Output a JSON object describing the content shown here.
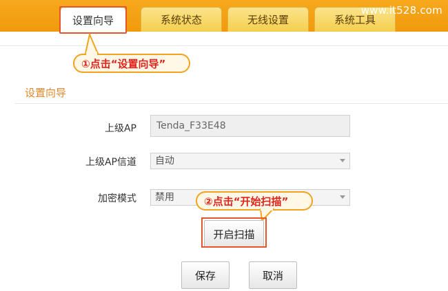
{
  "tabs": [
    {
      "label": "设置向导",
      "active": true
    },
    {
      "label": "系统状态",
      "active": false
    },
    {
      "label": "无线设置",
      "active": false
    },
    {
      "label": "系统工具",
      "active": false
    }
  ],
  "watermark": "www.it528.com",
  "callouts": {
    "step1": "①点击“设置向导”",
    "step2": "②点击“开始扫描”"
  },
  "section_title": "设置向导",
  "form": {
    "upstream_ap_label": "上级AP",
    "upstream_ap_value": "Tenda_F33E48",
    "upstream_channel_label": "上级AP信道",
    "upstream_channel_value": "自动",
    "encryption_label": "加密模式",
    "encryption_value": "禁用"
  },
  "buttons": {
    "scan": "开启扫描",
    "save": "保存",
    "cancel": "取消"
  },
  "colors": {
    "tab_bar": "#f29a0e",
    "highlight_border": "#e8542a",
    "callout_text": "#e0231b",
    "section_title": "#e0882a"
  }
}
